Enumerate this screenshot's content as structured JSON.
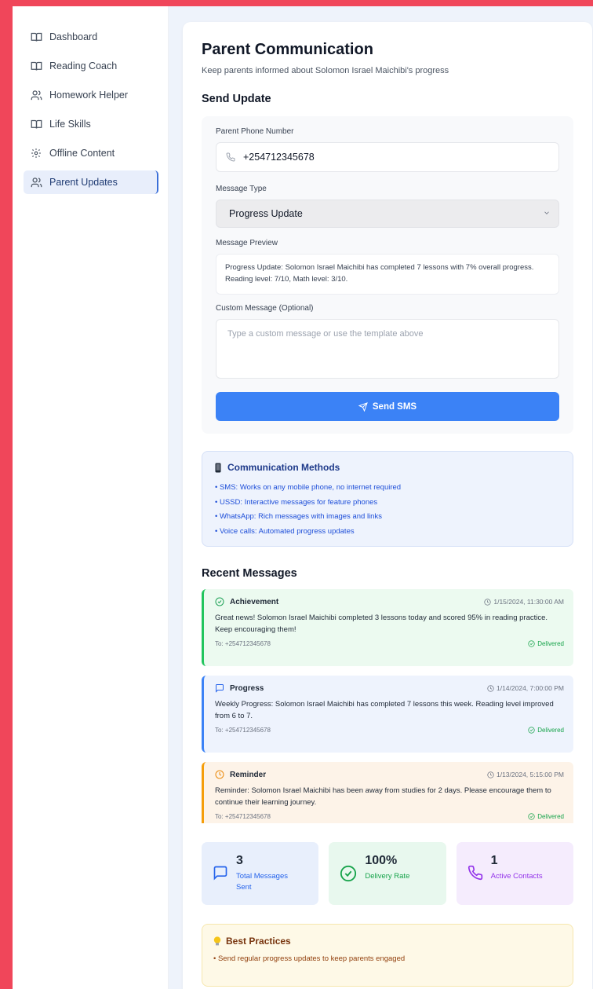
{
  "sidebar": {
    "items": [
      {
        "label": "Dashboard",
        "icon": "book-open-icon",
        "active": false
      },
      {
        "label": "Reading Coach",
        "icon": "book-open-icon",
        "active": false
      },
      {
        "label": "Homework Helper",
        "icon": "users-icon",
        "active": false
      },
      {
        "label": "Life Skills",
        "icon": "book-open-icon",
        "active": false
      },
      {
        "label": "Offline Content",
        "icon": "gear-icon",
        "active": false
      },
      {
        "label": "Parent Updates",
        "icon": "users-icon",
        "active": true
      }
    ]
  },
  "page": {
    "title": "Parent Communication",
    "subtitle": "Keep parents informed about Solomon Israel Maichibi's progress"
  },
  "send_update": {
    "heading": "Send Update",
    "phone_label": "Parent Phone Number",
    "phone_value": "+254712345678",
    "type_label": "Message Type",
    "type_value": "Progress Update",
    "preview_label": "Message Preview",
    "preview_text": "Progress Update: Solomon Israel Maichibi has completed 7 lessons with 7% overall progress. Reading level: 7/10, Math level: 3/10.",
    "custom_label": "Custom Message (Optional)",
    "custom_placeholder": "Type a custom message or use the template above",
    "send_label": "Send SMS"
  },
  "methods": {
    "title": "Communication Methods",
    "items": [
      "• SMS: Works on any mobile phone, no internet required",
      "• USSD: Interactive messages for feature phones",
      "• WhatsApp: Rich messages with images and links",
      "• Voice calls: Automated progress updates"
    ]
  },
  "recent": {
    "heading": "Recent Messages",
    "messages": [
      {
        "type": "Achievement",
        "time": "1/15/2024, 11:30:00 AM",
        "body": "Great news! Solomon Israel Maichibi completed 3 lessons today and scored 95% in reading practice. Keep encouraging them!",
        "to": "To: +254712345678",
        "status": "Delivered",
        "bg": "#ecfaf0",
        "border": "#22c55e",
        "icon_color": "#22a35a"
      },
      {
        "type": "Progress",
        "time": "1/14/2024, 7:00:00 PM",
        "body": "Weekly Progress: Solomon Israel Maichibi has completed 7 lessons this week. Reading level improved from 6 to 7.",
        "to": "To: +254712345678",
        "status": "Delivered",
        "bg": "#eef3fd",
        "border": "#3b82f6",
        "icon_color": "#2563eb"
      },
      {
        "type": "Reminder",
        "time": "1/13/2024, 5:15:00 PM",
        "body": "Reminder: Solomon Israel Maichibi has been away from studies for 2 days. Please encourage them to continue their learning journey.",
        "to": "To: +254712345678",
        "status": "Delivered",
        "bg": "#fdf3e8",
        "border": "#f59e0b",
        "icon_color": "#ea8a0c"
      }
    ]
  },
  "stats": [
    {
      "value": "3",
      "label": "Total Messages Sent",
      "bg": "#e8effc",
      "color": "#2563eb",
      "icon": "message-icon"
    },
    {
      "value": "100%",
      "label": "Delivery Rate",
      "bg": "#e8f8ee",
      "color": "#16a34a",
      "icon": "check-circle-icon"
    },
    {
      "value": "1",
      "label": "Active Contacts",
      "bg": "#f5ecfd",
      "color": "#9333ea",
      "icon": "phone-icon"
    }
  ],
  "best_practices": {
    "title": "Best Practices",
    "items": [
      "• Send regular progress updates to keep parents engaged"
    ]
  }
}
